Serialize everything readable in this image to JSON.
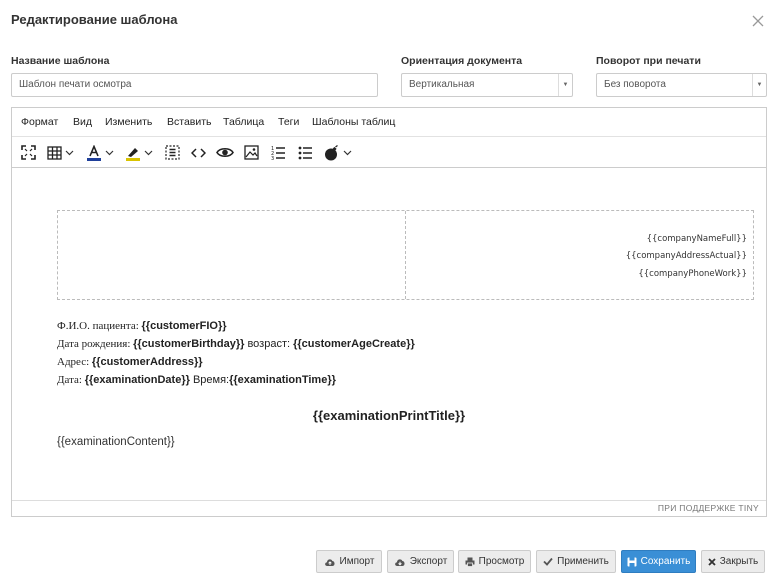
{
  "dialog": {
    "title": "Редактирование шаблона"
  },
  "fields": {
    "name_label": "Название шаблона",
    "name_value": "Шаблон печати осмотра",
    "orientation_label": "Ориентация документа",
    "orientation_value": "Вертикальная",
    "rotation_label": "Поворот при печати",
    "rotation_value": "Без поворота"
  },
  "menu": [
    "Формат",
    "Вид",
    "Изменить",
    "Вставить",
    "Таблица",
    "Теги",
    "Шаблоны таблиц"
  ],
  "editor": {
    "company_name": "{{companyNameFull}}",
    "company_address": "{{companyAddressActual}}",
    "company_phone": "{{companyPhoneWork}}",
    "patient_label": "Ф.И.О. пациента: ",
    "patient_tag": "{{customerFIO}}",
    "birthday_label": "Дата рождения: ",
    "birthday_tag": "{{customerBirthday}}",
    "age_label": " возраст: ",
    "age_tag": "{{customerAgeCreate}}",
    "address_label": "Адрес:  ",
    "address_tag": "{{customerAddress}}",
    "date_label": "Дата: ",
    "date_tag": "{{examinationDate}}",
    "time_label": " Время:",
    "time_tag": "{{examinationTime}}",
    "print_title": "{{examinationPrintTitle}}",
    "content": "{{examinationContent}}",
    "powered_by": "ПРИ ПОДДЕРЖКЕ TINY"
  },
  "buttons": {
    "import": "Импорт",
    "export": "Экспорт",
    "preview": "Просмотр",
    "apply": "Применить",
    "save": "Сохранить",
    "close": "Закрыть"
  },
  "colors": {
    "primary": "#3a8fd6",
    "text_color_bar": "#1f3f9a",
    "highlight_bar": "#d9c300"
  }
}
